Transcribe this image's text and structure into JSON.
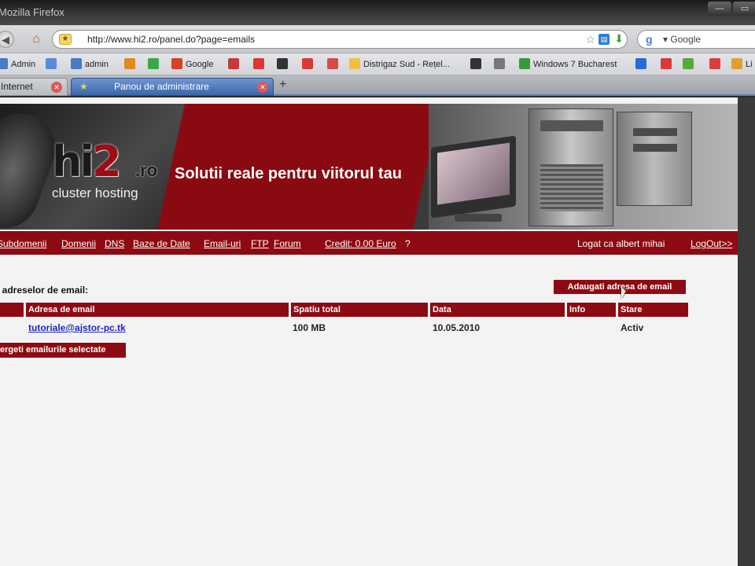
{
  "window": {
    "title": "Mozilla Firefox"
  },
  "nav": {
    "url": "http://www.hi2.ro/panel.do?page=emails",
    "search_engine": "Google"
  },
  "bookmarks": [
    {
      "label": "Admin",
      "color": "#4a7ac8"
    },
    {
      "label": "",
      "color": "#5a8ad8"
    },
    {
      "label": "admin",
      "color": "#4a7ac8"
    },
    {
      "label": "",
      "color": "#e08a20"
    },
    {
      "label": "",
      "color": "#3aa84a"
    },
    {
      "label": "Google",
      "color": "#d8402a"
    },
    {
      "label": "",
      "color": "#c83a3a"
    },
    {
      "label": "",
      "color": "#d83838"
    },
    {
      "label": "",
      "color": "#333333"
    },
    {
      "label": "",
      "color": "#d83a3a"
    },
    {
      "label": "",
      "color": "#d84a4a"
    },
    {
      "label": "Distrigaz Sud - Rețel...",
      "color": "#f0c040"
    },
    {
      "label": "",
      "color": "#333333"
    },
    {
      "label": "",
      "color": "#777777"
    },
    {
      "label": "Windows 7 Bucharest",
      "color": "#3a9a3a"
    },
    {
      "label": "",
      "color": "#2a6ad8"
    },
    {
      "label": "",
      "color": "#d83a3a"
    },
    {
      "label": "",
      "color": "#5aa83a"
    },
    {
      "label": "",
      "color": "#d84040"
    },
    {
      "label": "Li",
      "color": "#e0a030"
    }
  ],
  "tabs": [
    {
      "label": "Internet"
    },
    {
      "label": "Panou de administrare"
    }
  ],
  "banner": {
    "logo_main": "hi",
    "logo_two": "2",
    "logo_ro": ".ro",
    "logo_sub": "cluster hosting",
    "slogan": "Solutii reale pentru viitorul tau"
  },
  "menu": {
    "items": [
      "Subdomenii",
      "Domenii",
      "DNS",
      "Baze de Date",
      "Email-uri",
      "FTP",
      "Forum"
    ],
    "credit": "Credit: 0.00 Euro",
    "help": "?",
    "logged_as": "Logat ca albert mihai",
    "logout": "LogOut>>"
  },
  "emails": {
    "section_title": "ı adreselor de email:",
    "add_button": "Adaugati adresa de email",
    "columns": [
      "",
      "Adresa de email",
      "Spatiu total",
      "Data",
      "Info",
      "Stare"
    ],
    "rows": [
      {
        "email": "tutoriale@ajstor-pc.tk",
        "space": "100 MB",
        "date": "10.05.2010",
        "info": "",
        "status": "Activ"
      }
    ],
    "delete_button": "ergeti emailurile selectate"
  },
  "colors": {
    "brand_red": "#8e0a12",
    "link_blue": "#2222cc"
  }
}
